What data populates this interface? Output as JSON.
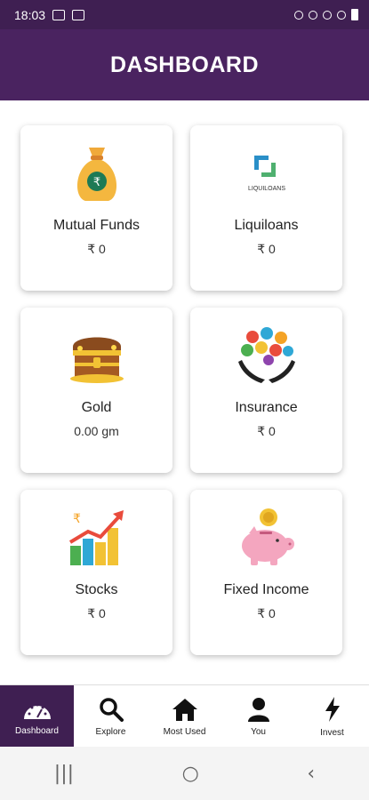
{
  "status_bar": {
    "time": "18:03",
    "battery_icon": "battery-icon"
  },
  "header": {
    "title": "DASHBOARD"
  },
  "cards": [
    {
      "label": "Mutual Funds",
      "value": "₹ 0",
      "icon": "money-bag-icon"
    },
    {
      "label": "Liquiloans",
      "value": "₹ 0",
      "icon": "liquiloans-logo",
      "logo_text": "LIQUILOANS"
    },
    {
      "label": "Gold",
      "value": "0.00 gm",
      "icon": "treasure-chest-icon"
    },
    {
      "label": "Insurance",
      "value": "₹ 0",
      "icon": "insurance-hands-icon"
    },
    {
      "label": "Stocks",
      "value": "₹ 0",
      "icon": "rising-chart-icon"
    },
    {
      "label": "Fixed Income",
      "value": "₹ 0",
      "icon": "piggy-bank-icon"
    }
  ],
  "bottom_nav": [
    {
      "label": "Dashboard",
      "icon": "speedometer-icon",
      "active": true
    },
    {
      "label": "Explore",
      "icon": "search-icon",
      "active": false
    },
    {
      "label": "Most Used",
      "icon": "home-icon",
      "active": false
    },
    {
      "label": "You",
      "icon": "user-icon",
      "active": false
    },
    {
      "label": "Invest",
      "icon": "lightning-icon",
      "active": false
    }
  ],
  "system_nav": {
    "recents": "|||",
    "home": "○",
    "back": "‹"
  },
  "colors": {
    "header": "#4a2360",
    "status_bar": "#3f1f52",
    "active_nav": "#3f1f52"
  }
}
